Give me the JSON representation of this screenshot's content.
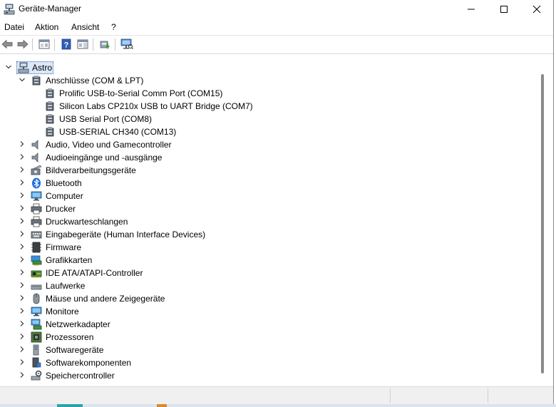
{
  "window": {
    "title": "Geräte-Manager",
    "icon": "device-manager-icon"
  },
  "menu": [
    "Datei",
    "Aktion",
    "Ansicht",
    "?"
  ],
  "toolbar": {
    "buttons": [
      "back-arrow-icon",
      "forward-arrow-icon",
      "properties-console-icon",
      "help-icon",
      "action-pane-icon",
      "update-driver-icon",
      "scan-hardware-icon"
    ]
  },
  "tree": {
    "root": {
      "label": "Astro",
      "icon": "computer-icon"
    },
    "expanded": {
      "label": "Anschlüsse (COM & LPT)",
      "icon": "port-icon",
      "children": [
        "Prolific USB-to-Serial Comm Port (COM15)",
        "Silicon Labs CP210x USB to UART Bridge (COM7)",
        "USB Serial Port (COM8)",
        "USB-SERIAL CH340 (COM13)"
      ]
    },
    "categories": [
      {
        "label": "Audio, Video und Gamecontroller",
        "icon": "speaker-icon"
      },
      {
        "label": "Audioeingänge und -ausgänge",
        "icon": "speaker-icon"
      },
      {
        "label": "Bildverarbeitungsgeräte",
        "icon": "camera-icon"
      },
      {
        "label": "Bluetooth",
        "icon": "bluetooth-icon"
      },
      {
        "label": "Computer",
        "icon": "monitor-icon"
      },
      {
        "label": "Drucker",
        "icon": "printer-icon"
      },
      {
        "label": "Druckwarteschlangen",
        "icon": "printer-icon"
      },
      {
        "label": "Eingabegeräte (Human Interface Devices)",
        "icon": "keyboard-icon"
      },
      {
        "label": "Firmware",
        "icon": "chip-icon"
      },
      {
        "label": "Grafikkarten",
        "icon": "display-adapter-icon"
      },
      {
        "label": "IDE ATA/ATAPI-Controller",
        "icon": "controller-icon"
      },
      {
        "label": "Laufwerke",
        "icon": "drive-icon"
      },
      {
        "label": "Mäuse und andere Zeigegeräte",
        "icon": "mouse-icon"
      },
      {
        "label": "Monitore",
        "icon": "monitor-icon"
      },
      {
        "label": "Netzwerkadapter",
        "icon": "network-icon"
      },
      {
        "label": "Prozessoren",
        "icon": "cpu-icon"
      },
      {
        "label": "Softwaregeräte",
        "icon": "software-device-icon"
      },
      {
        "label": "Softwarekomponenten",
        "icon": "software-component-icon"
      },
      {
        "label": "Speichercontroller",
        "icon": "storage-controller-icon"
      }
    ]
  }
}
